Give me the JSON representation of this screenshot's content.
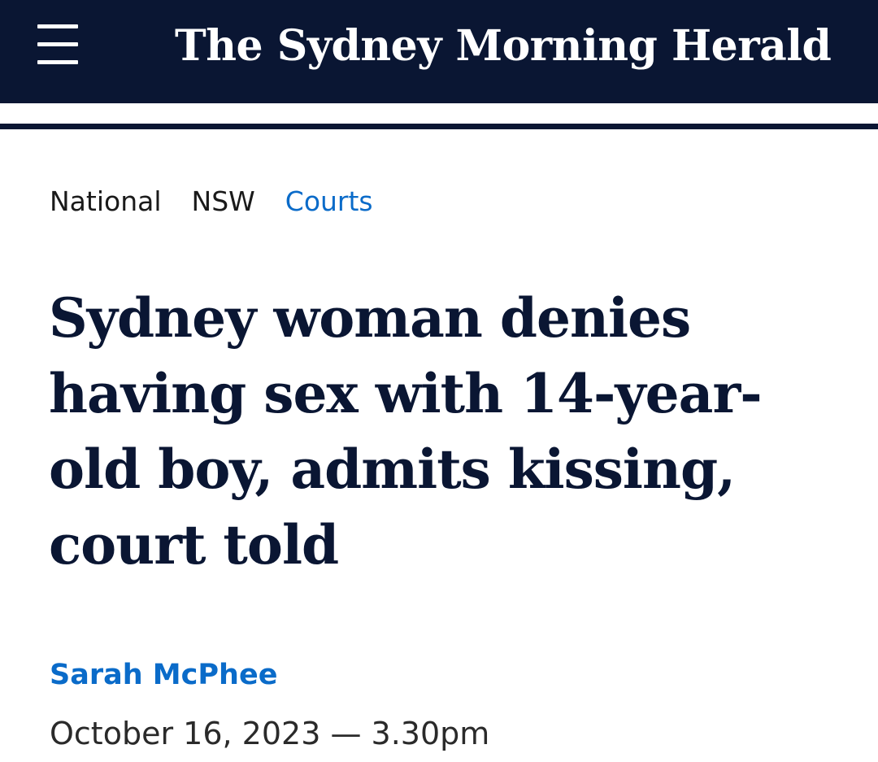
{
  "header": {
    "logo_text": "The Sydney Morning Herald",
    "menu_icon": "hamburger-menu-icon",
    "background_color": "#0a1633"
  },
  "breadcrumb": {
    "items": [
      {
        "label": "National"
      },
      {
        "label": "NSW"
      },
      {
        "label": "Courts"
      }
    ],
    "active_color": "#0a6bc9"
  },
  "article": {
    "headline": "Sydney woman denies having sex with 14-year-old boy, admits kissing, court told",
    "author": "Sarah McPhee",
    "timestamp": "October 16, 2023 — 3.30pm"
  }
}
